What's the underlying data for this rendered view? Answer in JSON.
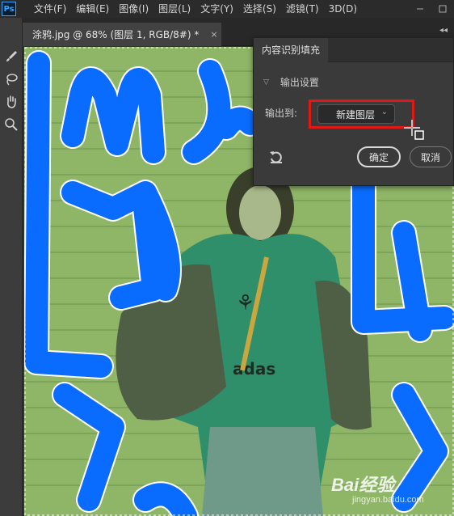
{
  "app": {
    "logo": "Ps"
  },
  "menu": [
    "文件(F)",
    "编辑(E)",
    "图像(I)",
    "图层(L)",
    "文字(Y)",
    "选择(S)",
    "滤镜(T)",
    "3D(D)"
  ],
  "document_tab": {
    "title": "涂鸦.jpg @ 68% (图层 1, RGB/8#) *",
    "close": "×"
  },
  "panel": {
    "title": "内容识别填充",
    "section_title": "输出设置",
    "output_label": "输出到:",
    "output_value": "新建图层",
    "ok_label": "确定",
    "cancel_label": "取消"
  },
  "watermark": {
    "main": "Bai经验",
    "sub": "jingyan.baidu.com"
  },
  "colors": {
    "scribble": "#0a6cff",
    "canvas_bg": "#8fb567",
    "highlight": "#e01818"
  },
  "icons": [
    "brush-icon",
    "lasso-icon",
    "hand-icon",
    "zoom-icon",
    "reset-icon",
    "close-icon",
    "chevron-down-icon",
    "crosshair-cursor-icon"
  ]
}
